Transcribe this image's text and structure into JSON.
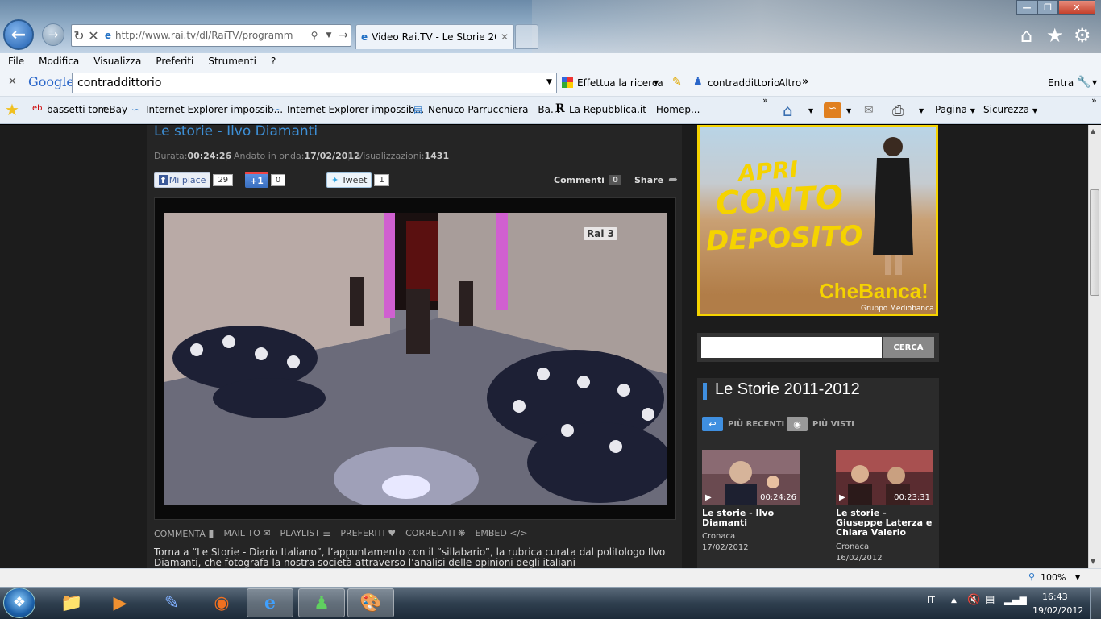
{
  "browser": {
    "address_url": "http://www.rai.tv/dl/RaiTV/programm",
    "tab_title": "Video Rai.TV - Le Storie 201...",
    "menu": [
      "File",
      "Modifica",
      "Visualizza",
      "Preferiti",
      "Strumenti",
      "?"
    ]
  },
  "google_toolbar": {
    "logo": "Google",
    "query": "contraddittorio",
    "search_btn": "Effettua la ricerca",
    "highlight_term": "contraddittorio",
    "more": "Altro",
    "signin": "Entra"
  },
  "favorites": {
    "items": [
      "bassetti tom",
      "eBay",
      "Internet Explorer impossib...",
      "Internet Explorer impossib...",
      "Nenuco Parrucchiera - Ba...",
      "La Repubblica.it - Homep..."
    ],
    "commands": {
      "page": "Pagina",
      "security": "Sicurezza"
    }
  },
  "video": {
    "title": "Le storie - Ilvo Diamanti",
    "duration_label": "Durata:",
    "duration": "00:24:26",
    "aired_label": "Andato in onda:",
    "aired": "17/02/2012",
    "views_label": "Visualizzazioni:",
    "views": "1431",
    "like_label": "Mi piace",
    "like_count": "29",
    "plus_label": "+1",
    "plus_count": "0",
    "tweet_label": "Tweet",
    "tweet_count": "1",
    "comments_label": "Commenti",
    "comments_count": "0",
    "share_label": "Share",
    "channel_logo": "Rai 3",
    "actions": [
      "COMMENTA",
      "MAIL TO",
      "PLAYLIST",
      "PREFERITI",
      "CORRELATI",
      "EMBED"
    ],
    "description": "Torna a “Le Storie - Diario Italiano”, l’appuntamento con il “sillabario”, la rubrica curata dal politologo Ilvo Diamanti, che fotografa la nostra società attraverso l’analisi delle opinioni degli italiani"
  },
  "ad": {
    "line1": "APRI",
    "line2": "CONTO",
    "line3": "DEPOSITO",
    "brand": "CheBanca!",
    "group": "Gruppo Mediobanca"
  },
  "sidebar_search": {
    "button": "CERCA"
  },
  "playlist": {
    "title": "Le Storie 2011-2012",
    "tab_recent": "PIÙ RECENTI",
    "tab_viewed": "PIÙ VISTI",
    "items": [
      {
        "title": "Le storie - Ilvo Diamanti",
        "duration": "00:24:26",
        "category": "Cronaca",
        "date": "17/02/2012"
      },
      {
        "title": "Le storie - Giuseppe Laterza e Chiara Valerio",
        "duration": "00:23:31",
        "category": "Cronaca",
        "date": "16/02/2012"
      }
    ]
  },
  "status": {
    "zoom": "100%"
  },
  "taskbar": {
    "lang": "IT",
    "time": "16:43",
    "date": "19/02/2012"
  },
  "colors": {
    "link_blue": "#3d8fd6",
    "ad_yellow": "#f5d300",
    "playlist_accent": "#3f8fe0"
  }
}
